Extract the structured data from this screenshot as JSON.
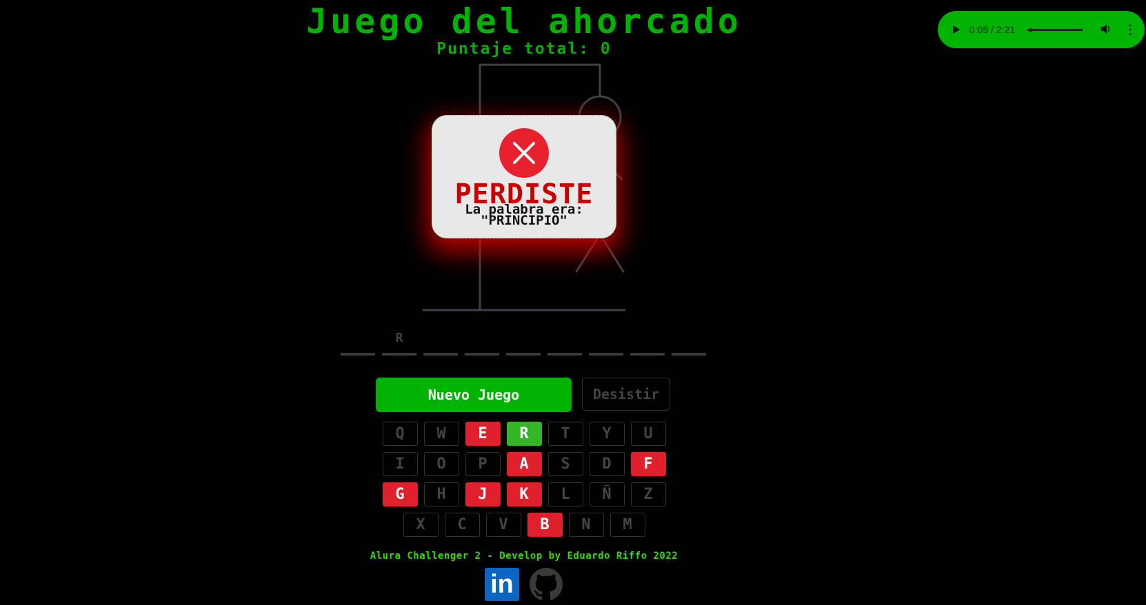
{
  "header": {
    "title": "Juego del ahorcado",
    "score": "Puntaje total: 0"
  },
  "audio": {
    "time": "0:05 / 2:21",
    "progress": 0.04
  },
  "modal": {
    "result": "PERDISTE",
    "message_line1": "La palabra era:",
    "message_line2": "\"PRINCIPIO\""
  },
  "word_slots": [
    "",
    "R",
    "",
    "",
    "",
    "",
    "",
    "",
    ""
  ],
  "buttons": {
    "new_game": "Nuevo Juego",
    "give_up": "Desistir"
  },
  "keyboard": [
    [
      {
        "k": "Q",
        "s": ""
      },
      {
        "k": "W",
        "s": ""
      },
      {
        "k": "E",
        "s": "wrong"
      },
      {
        "k": "R",
        "s": "right"
      },
      {
        "k": "T",
        "s": ""
      },
      {
        "k": "Y",
        "s": ""
      },
      {
        "k": "U",
        "s": ""
      }
    ],
    [
      {
        "k": "I",
        "s": ""
      },
      {
        "k": "O",
        "s": ""
      },
      {
        "k": "P",
        "s": ""
      },
      {
        "k": "A",
        "s": "wrong"
      },
      {
        "k": "S",
        "s": ""
      },
      {
        "k": "D",
        "s": ""
      },
      {
        "k": "F",
        "s": "wrong"
      }
    ],
    [
      {
        "k": "G",
        "s": "wrong"
      },
      {
        "k": "H",
        "s": ""
      },
      {
        "k": "J",
        "s": "wrong"
      },
      {
        "k": "K",
        "s": "wrong"
      },
      {
        "k": "L",
        "s": ""
      },
      {
        "k": "Ñ",
        "s": ""
      },
      {
        "k": "Z",
        "s": ""
      }
    ],
    [
      {
        "k": "X",
        "s": ""
      },
      {
        "k": "C",
        "s": ""
      },
      {
        "k": "V",
        "s": ""
      },
      {
        "k": "B",
        "s": "wrong"
      },
      {
        "k": "N",
        "s": ""
      },
      {
        "k": "M",
        "s": ""
      }
    ]
  ],
  "footer": {
    "credit": "Alura Challenger 2 - Develop by Eduardo Riffo 2022",
    "linkedin_label": "in"
  },
  "colors": {
    "accent": "#00b300",
    "wrong": "#e0202c",
    "right": "#33b526",
    "lose": "#c80000"
  }
}
